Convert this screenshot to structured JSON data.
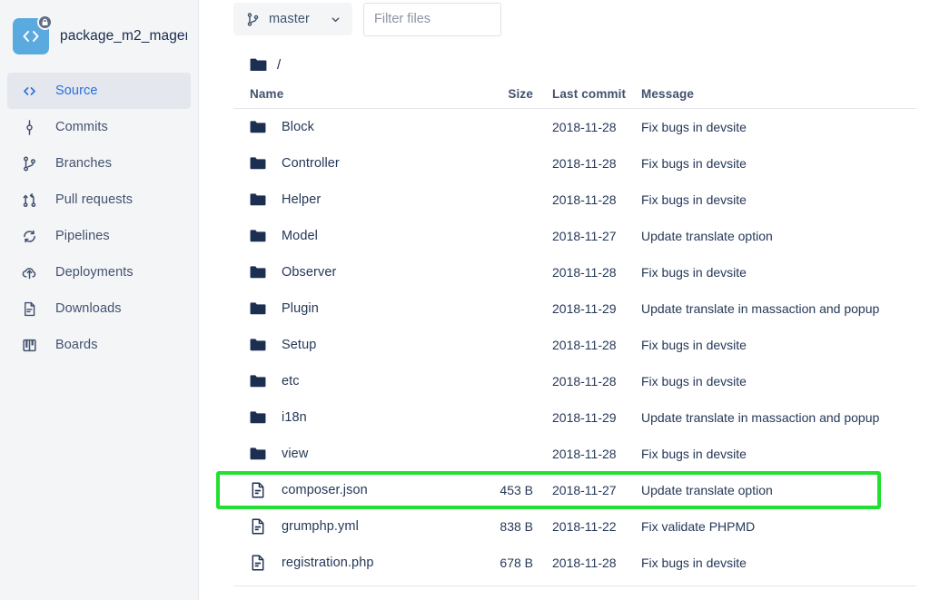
{
  "sidebar": {
    "repo": {
      "name": "package_m2_magen…",
      "avatar_icon": "code-brackets-icon",
      "avatar_color": "#5aaae0",
      "badge_icon": "lock-icon"
    },
    "items": [
      {
        "label": "Source",
        "icon": "code-brackets-icon",
        "active": true
      },
      {
        "label": "Commits",
        "icon": "commit-icon",
        "active": false
      },
      {
        "label": "Branches",
        "icon": "branch-icon",
        "active": false
      },
      {
        "label": "Pull requests",
        "icon": "pull-request-icon",
        "active": false
      },
      {
        "label": "Pipelines",
        "icon": "pipelines-icon",
        "active": false
      },
      {
        "label": "Deployments",
        "icon": "deployments-icon",
        "active": false
      },
      {
        "label": "Downloads",
        "icon": "downloads-icon",
        "active": false
      },
      {
        "label": "Boards",
        "icon": "boards-icon",
        "active": false
      }
    ]
  },
  "toolbar": {
    "branch": {
      "label": "master",
      "icon": "branch-icon",
      "chevron": "chevron-down-icon"
    },
    "filter": {
      "value": "",
      "placeholder": "Filter files"
    }
  },
  "breadcrumb": {
    "icon": "folder-icon",
    "path": "/"
  },
  "table": {
    "headers": {
      "name": "Name",
      "size": "Size",
      "last_commit": "Last commit",
      "message": "Message"
    },
    "rows": [
      {
        "name": "Block",
        "type": "folder",
        "size": "",
        "date": "2018-11-28",
        "message": "Fix bugs in devsite"
      },
      {
        "name": "Controller",
        "type": "folder",
        "size": "",
        "date": "2018-11-28",
        "message": "Fix bugs in devsite"
      },
      {
        "name": "Helper",
        "type": "folder",
        "size": "",
        "date": "2018-11-28",
        "message": "Fix bugs in devsite"
      },
      {
        "name": "Model",
        "type": "folder",
        "size": "",
        "date": "2018-11-27",
        "message": "Update translate option"
      },
      {
        "name": "Observer",
        "type": "folder",
        "size": "",
        "date": "2018-11-28",
        "message": "Fix bugs in devsite"
      },
      {
        "name": "Plugin",
        "type": "folder",
        "size": "",
        "date": "2018-11-29",
        "message": "Update translate in massaction and popup"
      },
      {
        "name": "Setup",
        "type": "folder",
        "size": "",
        "date": "2018-11-28",
        "message": "Fix bugs in devsite"
      },
      {
        "name": "etc",
        "type": "folder",
        "size": "",
        "date": "2018-11-28",
        "message": "Fix bugs in devsite"
      },
      {
        "name": "i18n",
        "type": "folder",
        "size": "",
        "date": "2018-11-29",
        "message": "Update translate in massaction and popup"
      },
      {
        "name": "view",
        "type": "folder",
        "size": "",
        "date": "2018-11-28",
        "message": "Fix bugs in devsite"
      },
      {
        "name": "composer.json",
        "type": "file",
        "size": "453 B",
        "date": "2018-11-27",
        "message": "Update translate option",
        "highlighted": true
      },
      {
        "name": "grumphp.yml",
        "type": "file",
        "size": "838 B",
        "date": "2018-11-22",
        "message": "Fix validate PHPMD"
      },
      {
        "name": "registration.php",
        "type": "file",
        "size": "678 B",
        "date": "2018-11-28",
        "message": "Fix bugs in devsite"
      }
    ]
  },
  "annotation": {
    "target_row": "composer.json",
    "highlight_color": "#22e032"
  }
}
